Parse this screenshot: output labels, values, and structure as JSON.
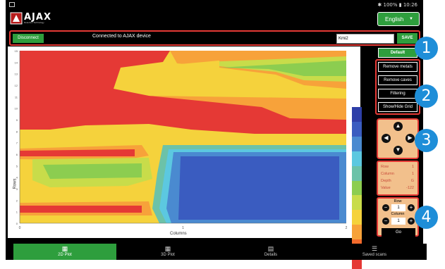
{
  "status_bar": {
    "right": "✱ 100% ▮ 10:26"
  },
  "brand": {
    "logo_text": "AJAX",
    "tagline": "Detection Technology"
  },
  "language": {
    "label": "English"
  },
  "connection": {
    "disconnect_label": "Disconnect",
    "status_text": "Connected to AJAX device",
    "scan_name_value": "Kmi2",
    "save_label": "SAVE"
  },
  "plot": {
    "y_axis_label": "Rows",
    "x_axis_label": "Columns",
    "y_ticks": [
      "0",
      "1",
      "2",
      "3",
      "4",
      "5",
      "6",
      "7",
      "8",
      "9",
      "10",
      "11",
      "12",
      "13",
      "14",
      "15"
    ],
    "x_ticks": [
      "0",
      "1",
      "2"
    ]
  },
  "side_buttons": {
    "default": "Default",
    "remove_metals": "Remove metals",
    "remove_caves": "Remove caves",
    "filtering": "Filtering",
    "show_hide_grid": "Show/Hide Grid"
  },
  "info_panel": {
    "row_label": "Row",
    "row_value": "1",
    "column_label": "Column",
    "column_value": "1",
    "depth_label": "Depth",
    "depth_value": "G",
    "value_label": "Value",
    "value_value": "-122"
  },
  "goto_panel": {
    "row_label": "Row",
    "row_value": "1",
    "column_label": "Column",
    "column_value": "1",
    "go_label": "Go"
  },
  "callouts": [
    "1",
    "2",
    "3",
    "4"
  ],
  "tabs": [
    {
      "label": "2D Plot",
      "icon": "grid-icon",
      "active": true
    },
    {
      "label": "3D Plot",
      "icon": "grid-icon",
      "active": false
    },
    {
      "label": "Details",
      "icon": "clipboard-icon",
      "active": false
    },
    {
      "label": "Saved scans",
      "icon": "list-icon",
      "active": false
    }
  ],
  "colors": {
    "accent_green": "#2e9e3d",
    "highlight_red": "#e53935",
    "callout_blue": "#1e8ed8",
    "panel_peach": "#f2c08c",
    "legend_scale": [
      "#e53935",
      "#f36b2c",
      "#f7a23a",
      "#f5d23c",
      "#c8dc4a",
      "#8ccd50",
      "#6cc2a8",
      "#5cc8e0",
      "#4a8ad0",
      "#3a5cc0",
      "#2e3fa8"
    ]
  }
}
